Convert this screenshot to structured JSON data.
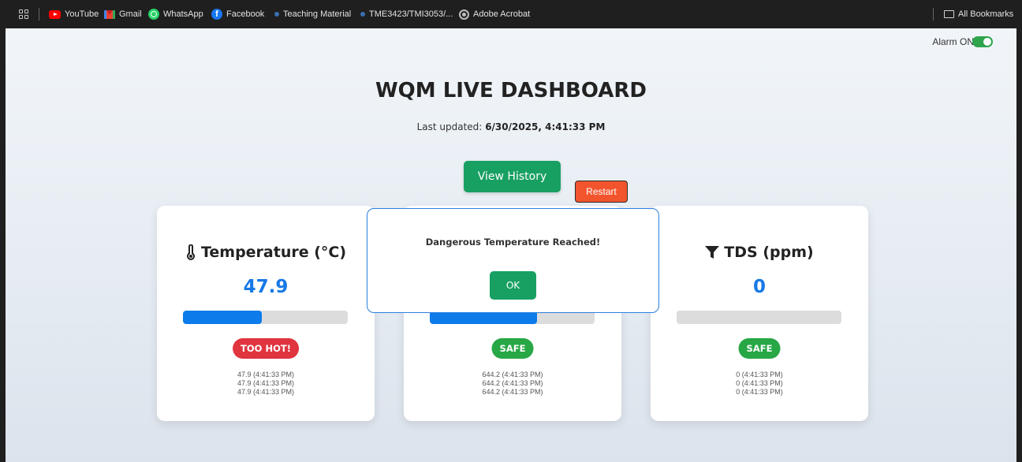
{
  "bookmarks_bar": {
    "items": [
      {
        "label": "YouTube",
        "icon": "youtube-icon"
      },
      {
        "label": "Gmail",
        "icon": "gmail-icon"
      },
      {
        "label": "WhatsApp",
        "icon": "whatsapp-icon"
      },
      {
        "label": "Facebook",
        "icon": "facebook-icon"
      },
      {
        "label": "Teaching Material",
        "icon": "bookmark-dot-icon"
      },
      {
        "label": "TME3423/TMI3053/...",
        "icon": "bookmark-dot-icon"
      },
      {
        "label": "Adobe Acrobat",
        "icon": "globe-icon"
      }
    ],
    "all_bookmarks": "All Bookmarks"
  },
  "alarm": {
    "label": "Alarm ON",
    "state": "on"
  },
  "header": {
    "title": "WQM LIVE DASHBOARD",
    "updated_prefix": "Last updated:",
    "updated_value": "6/30/2025, 4:41:33 PM"
  },
  "buttons": {
    "view_history": "View History",
    "restart": "Restart"
  },
  "cards": [
    {
      "title": "Temperature (°C)",
      "icon": "thermometer-icon",
      "value": "47.9",
      "level": 0.48,
      "status": "TOO HOT!",
      "status_color": "#e0343f",
      "history": [
        "47.9 (4:41:33 PM)",
        "47.9 (4:41:33 PM)",
        "47.9 (4:41:33 PM)"
      ]
    },
    {
      "title": "",
      "icon": "",
      "value": "",
      "level": 0.65,
      "status": "SAFE",
      "status_color": "#27a745",
      "history": [
        "644.2 (4:41:33 PM)",
        "644.2 (4:41:33 PM)",
        "644.2 (4:41:33 PM)"
      ]
    },
    {
      "title": "TDS (ppm)",
      "icon": "filter-icon",
      "value": "0",
      "level": 0,
      "status": "SAFE",
      "status_color": "#27a745",
      "history": [
        "0 (4:41:33 PM)",
        "0 (4:41:33 PM)",
        "0 (4:41:33 PM)"
      ]
    }
  ],
  "modal": {
    "message": "Dangerous Temperature Reached!",
    "ok_label": "OK"
  },
  "colors": {
    "accent_green": "#18a063",
    "value_blue": "#1779e6",
    "restart_orange": "#f2552d"
  }
}
